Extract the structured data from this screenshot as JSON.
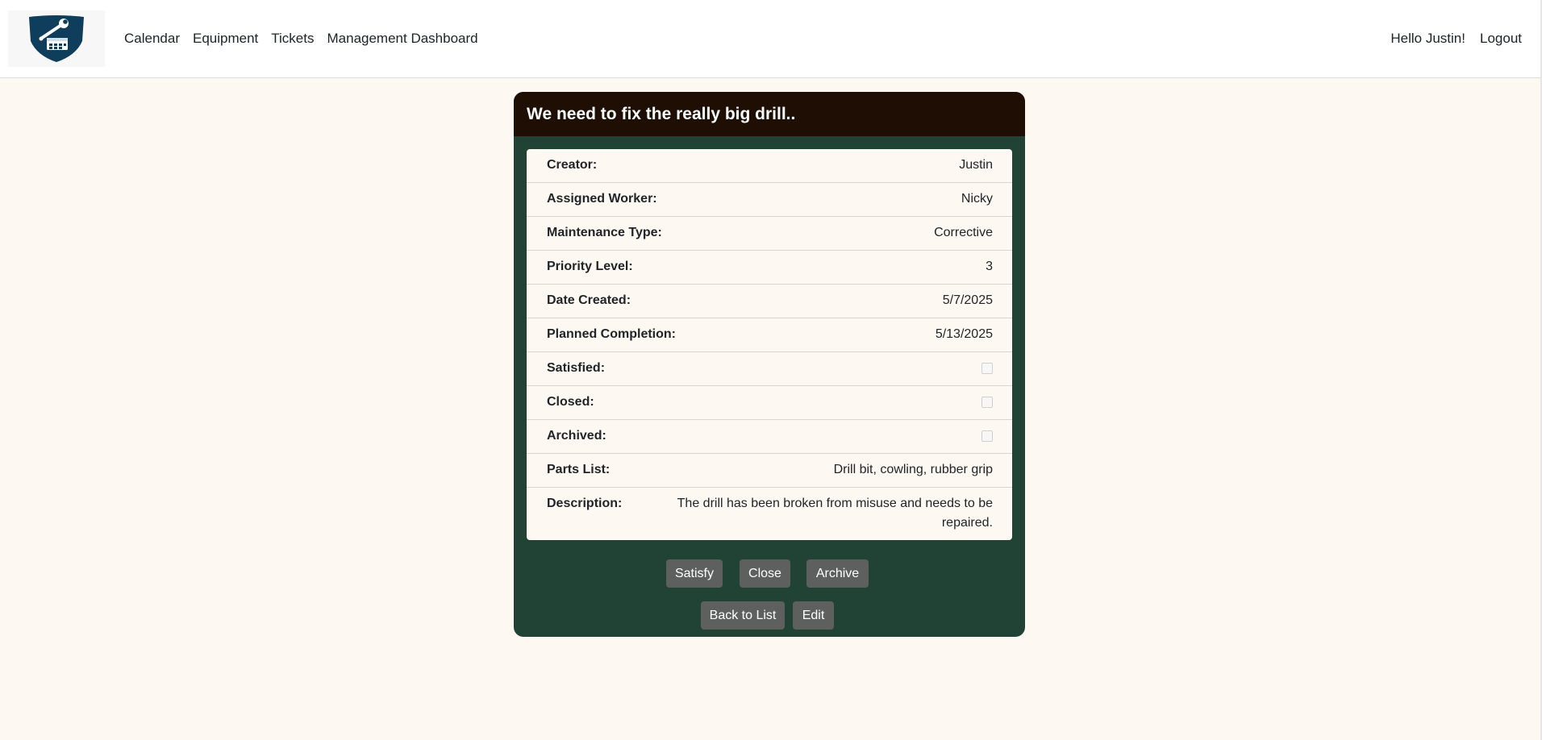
{
  "nav": {
    "links": [
      "Calendar",
      "Equipment",
      "Tickets",
      "Management Dashboard"
    ],
    "greeting": "Hello Justin!",
    "logout": "Logout"
  },
  "ticket": {
    "title": "We need to fix the really big drill..",
    "fields": [
      {
        "label": "Creator:",
        "value": "Justin"
      },
      {
        "label": "Assigned Worker:",
        "value": "Nicky"
      },
      {
        "label": "Maintenance Type:",
        "value": "Corrective"
      },
      {
        "label": "Priority Level:",
        "value": "3"
      },
      {
        "label": "Date Created:",
        "value": "5/7/2025"
      },
      {
        "label": "Planned Completion:",
        "value": "5/13/2025"
      },
      {
        "label": "Satisfied:",
        "checked": false
      },
      {
        "label": "Closed:",
        "checked": false
      },
      {
        "label": "Archived:",
        "checked": false
      },
      {
        "label": "Parts List:",
        "value": "Drill bit, cowling, rubber grip"
      },
      {
        "label": "Description:",
        "value": "The drill has been broken from misuse and needs to be repaired."
      }
    ]
  },
  "actions": {
    "satisfy": "Satisfy",
    "close": "Close",
    "archive": "Archive",
    "back": "Back to List",
    "edit": "Edit"
  },
  "colors": {
    "page_bg": "#fdf8f2",
    "card_bg": "#214336",
    "header_bg": "#1e0e04",
    "button_bg": "#5e6060",
    "logo_shield": "#0f3d5c"
  },
  "icons": {
    "logo": "wrench-calendar-shield-icon"
  }
}
